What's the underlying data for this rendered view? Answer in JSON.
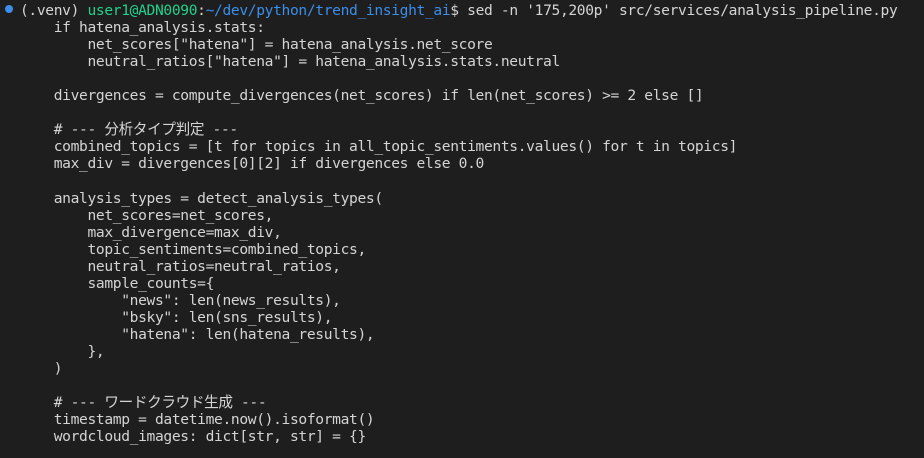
{
  "prompt": {
    "venv": "(.venv)",
    "user_host": "user1@ADN0090",
    "separator": ":",
    "path": "~/dev/python/trend_insight_ai",
    "symbol": "$",
    "command": "sed -n '175,200p' src/services/analysis_pipeline.py",
    "marker_color": "#3b8eea",
    "user_color": "#23d18b",
    "path_color": "#3b8eea"
  },
  "output_lines": [
    "    if hatena_analysis.stats:",
    "        net_scores[\"hatena\"] = hatena_analysis.net_score",
    "        neutral_ratios[\"hatena\"] = hatena_analysis.stats.neutral",
    "",
    "    divergences = compute_divergences(net_scores) if len(net_scores) >= 2 else []",
    "",
    "    # --- 分析タイプ判定 ---",
    "    combined_topics = [t for topics in all_topic_sentiments.values() for t in topics]",
    "    max_div = divergences[0][2] if divergences else 0.0",
    "",
    "    analysis_types = detect_analysis_types(",
    "        net_scores=net_scores,",
    "        max_divergence=max_div,",
    "        topic_sentiments=combined_topics,",
    "        neutral_ratios=neutral_ratios,",
    "        sample_counts={",
    "            \"news\": len(news_results),",
    "            \"bsky\": len(sns_results),",
    "            \"hatena\": len(hatena_results),",
    "        },",
    "    )",
    "",
    "    # --- ワードクラウド生成 ---",
    "    timestamp = datetime.now().isoformat()",
    "    wordcloud_images: dict[str, str] = {}"
  ]
}
